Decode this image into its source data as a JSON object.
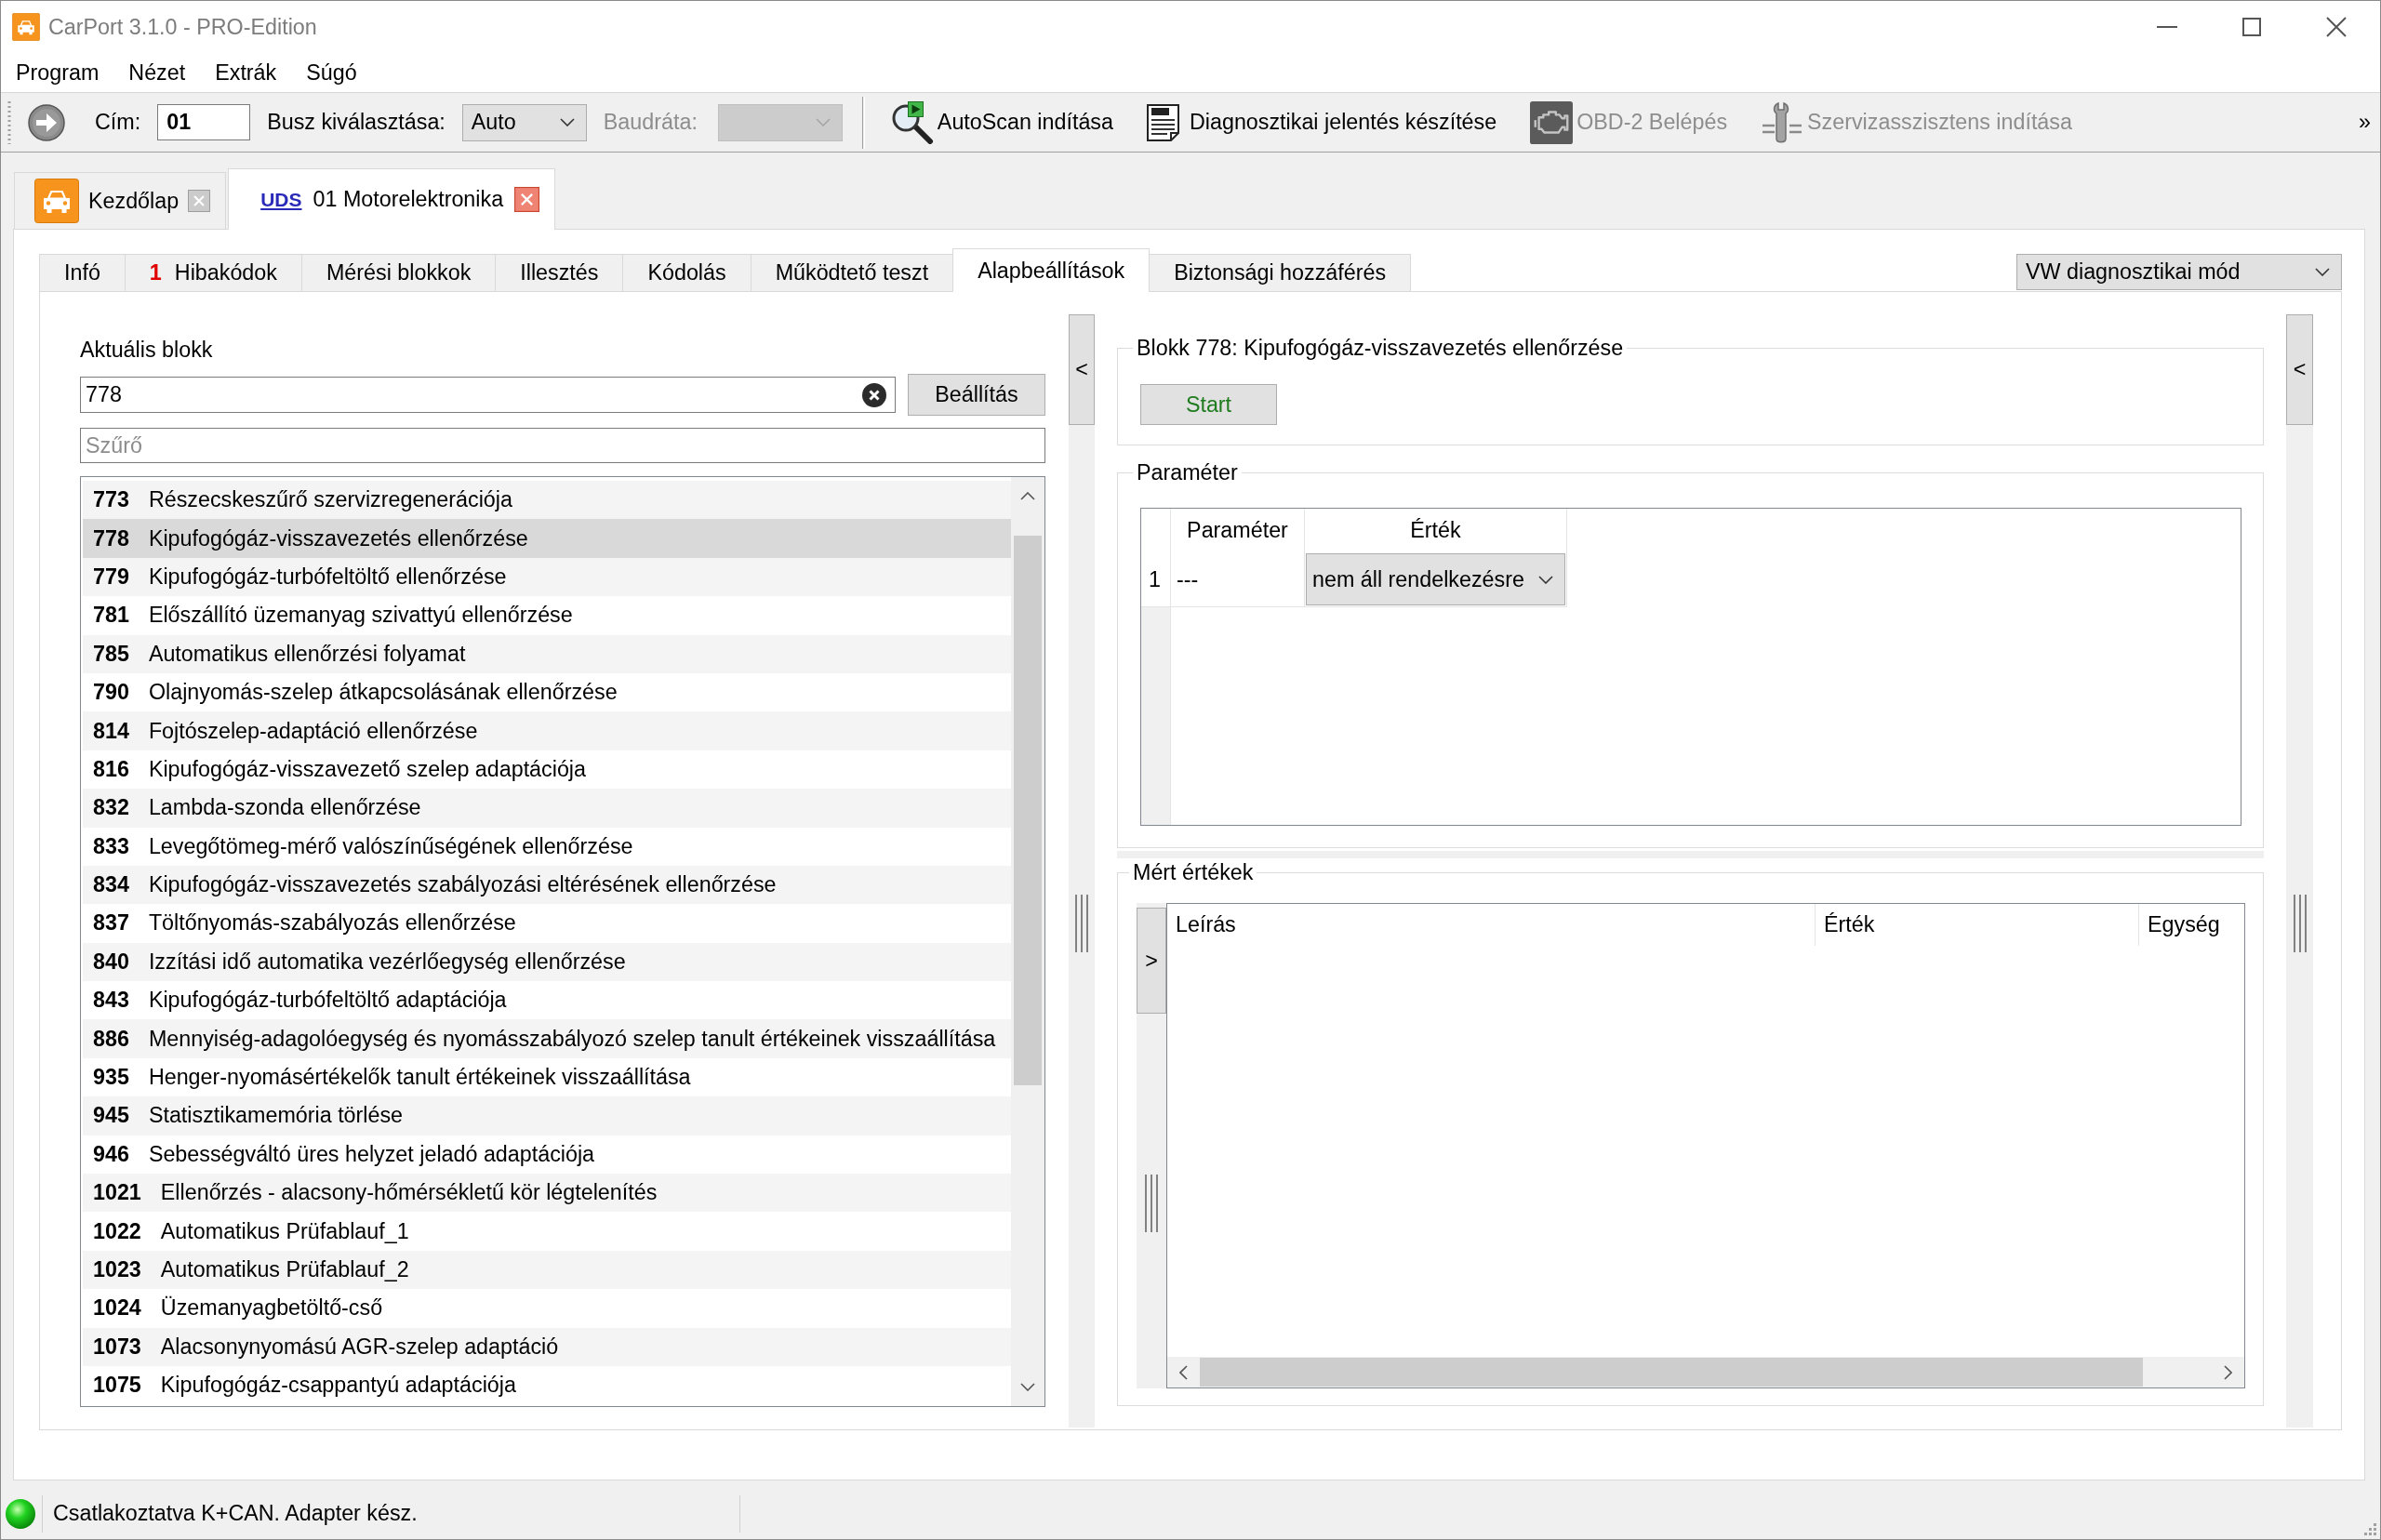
{
  "window": {
    "title": "CarPort 3.1.0 - PRO-Edition"
  },
  "menu": [
    {
      "label": "Program"
    },
    {
      "label": "Nézet"
    },
    {
      "label": "Extrák"
    },
    {
      "label": "Súgó"
    }
  ],
  "toolbar": {
    "address": {
      "label": "Cím:",
      "value": "01"
    },
    "bus": {
      "label": "Busz kiválasztása:",
      "value": "Auto"
    },
    "baud": {
      "label": "Baudráta:",
      "disabled": true
    },
    "buttons": [
      {
        "kind": "autoscan",
        "label": "AutoScan indítása",
        "disabled": false
      },
      {
        "kind": "report",
        "label": "Diagnosztikai jelentés készítése",
        "disabled": false
      },
      {
        "kind": "obd",
        "label": "OBD-2 Belépés",
        "disabled": true
      },
      {
        "kind": "service",
        "label": "Szervizasszisztens indítása",
        "disabled": true
      }
    ],
    "overflow": "»"
  },
  "document_tabs": [
    {
      "kind": "home",
      "label": "Kezdőlap",
      "selected": false
    },
    {
      "kind": "module",
      "protocol": "UDS",
      "label": "01 Motorelektronika",
      "selected": true
    }
  ],
  "tabs": [
    {
      "label": "Infó",
      "selected": false
    },
    {
      "count": "1",
      "label": "Hibakódok",
      "selected": false
    },
    {
      "label": "Mérési blokkok",
      "selected": false
    },
    {
      "label": "Illesztés",
      "selected": false
    },
    {
      "label": "Kódolás",
      "selected": false
    },
    {
      "label": "Működtető teszt",
      "selected": false
    },
    {
      "label": "Alapbeállítások",
      "selected": true
    },
    {
      "label": "Biztonsági hozzáférés",
      "selected": false
    }
  ],
  "mode_select": {
    "value": "VW diagnosztikai mód"
  },
  "block_panel": {
    "label": "Aktuális blokk",
    "value": "778",
    "apply_button": "Beállítás",
    "filter": {
      "placeholder": "Szűrő"
    },
    "blocks": [
      {
        "number": "773",
        "name": "Részecskeszűrő szervizregenerációja",
        "selected": false
      },
      {
        "number": "778",
        "name": "Kipufogógáz-visszavezetés ellenőrzése",
        "selected": true
      },
      {
        "number": "779",
        "name": "Kipufogógáz-turbófeltöltő ellenőrzése",
        "selected": false
      },
      {
        "number": "781",
        "name": "Előszállító üzemanyag szivattyú ellenőrzése",
        "selected": false
      },
      {
        "number": "785",
        "name": "Automatikus ellenőrzési folyamat",
        "selected": false
      },
      {
        "number": "790",
        "name": "Olajnyomás-szelep átkapcsolásának ellenőrzése",
        "selected": false
      },
      {
        "number": "814",
        "name": "Fojtószelep-adaptáció ellenőrzése",
        "selected": false
      },
      {
        "number": "816",
        "name": "Kipufogógáz-visszavezető szelep adaptációja",
        "selected": false
      },
      {
        "number": "832",
        "name": "Lambda-szonda ellenőrzése",
        "selected": false
      },
      {
        "number": "833",
        "name": "Levegőtömeg-mérő valószínűségének ellenőrzése",
        "selected": false
      },
      {
        "number": "834",
        "name": "Kipufogógáz-visszavezetés szabályozási eltérésének ellenőrzése",
        "selected": false
      },
      {
        "number": "837",
        "name": "Töltőnyomás-szabályozás ellenőrzése",
        "selected": false
      },
      {
        "number": "840",
        "name": "Izzítási idő automatika vezérlőegység ellenőrzése",
        "selected": false
      },
      {
        "number": "843",
        "name": "Kipufogógáz-turbófeltöltő adaptációja",
        "selected": false
      },
      {
        "number": "886",
        "name": "Mennyiség-adagolóegység és nyomásszabályozó szelep tanult értékeinek visszaállítása",
        "selected": false
      },
      {
        "number": "935",
        "name": "Henger-nyomásértékelők tanult értékeinek visszaállítása",
        "selected": false
      },
      {
        "number": "945",
        "name": "Statisztikamemória törlése",
        "selected": false
      },
      {
        "number": "946",
        "name": "Sebességváltó üres helyzet jeladó adaptációja",
        "selected": false
      },
      {
        "number": "1021",
        "name": "Ellenőrzés - alacsony-hőmérsékletű kör légtelenítés",
        "selected": false
      },
      {
        "number": "1022",
        "name": "Automatikus Prüfablauf_1",
        "selected": false
      },
      {
        "number": "1023",
        "name": "Automatikus Prüfablauf_2",
        "selected": false
      },
      {
        "number": "1024",
        "name": "Üzemanyagbetöltő-cső",
        "selected": false
      },
      {
        "number": "1073",
        "name": "Alacsonynyomású AGR-szelep adaptáció",
        "selected": false
      },
      {
        "number": "1075",
        "name": "Kipufogógáz-csappantyú adaptációja",
        "selected": false
      }
    ]
  },
  "left_splitter": {
    "button": "<"
  },
  "block_group": {
    "title": "Blokk 778: Kipufogógáz-visszavezetés ellenőrzése",
    "start_button": "Start"
  },
  "parameters": {
    "title": "Paraméter",
    "columns": [
      "Paraméter",
      "Érték"
    ],
    "rows": [
      {
        "index": "1",
        "name": "---",
        "value": "nem áll rendelkezésre"
      }
    ]
  },
  "measured_values": {
    "title": "Mért értékek",
    "expand_button": ">",
    "columns": [
      "Leírás",
      "Érték",
      "Egység"
    ]
  },
  "right_splitter": {
    "button": "<"
  },
  "status_bar": {
    "connected": true,
    "text": "Csatlakoztatva K+CAN. Adapter kész."
  }
}
